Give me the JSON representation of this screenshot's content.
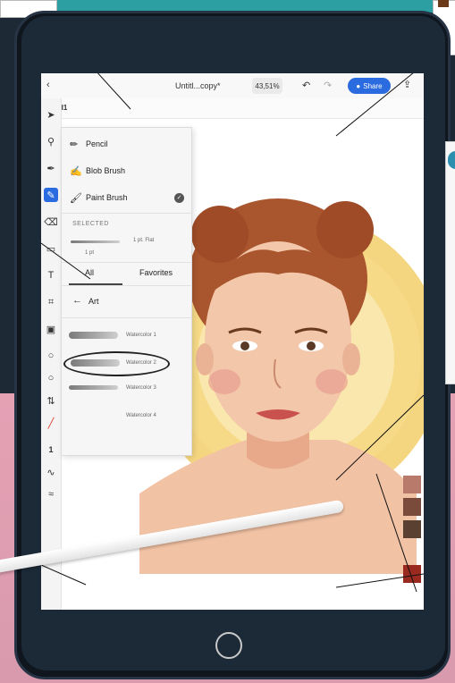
{
  "toolbar_top": {
    "back_icon": "chevron-left-icon",
    "doc_title": "Untitl...copy*",
    "zoom": "43,51%",
    "share_label": "Share",
    "layer_label": "d1"
  },
  "brush_panel": {
    "tools": [
      {
        "label": "Pencil",
        "icon": "pencil-icon"
      },
      {
        "label": "Blob Brush",
        "icon": "blob-brush-icon"
      },
      {
        "label": "Paint Brush",
        "icon": "paint-brush-icon",
        "selected": true
      }
    ],
    "selected_header": "SELECTED",
    "selected_stroke_label": "1 pt. Flat",
    "selected_size": "1 pt",
    "tabs": [
      "All",
      "Favorites"
    ],
    "category": "Art",
    "brushes": [
      "Watercolor 1",
      "Watercolor 2",
      "Watercolor 3",
      "Watercolor 4"
    ]
  },
  "left_tools": {
    "stroke_size": "1"
  },
  "colors": {
    "accent": "#2b6be0",
    "hair": "#a8542d",
    "skin": "#f2c4a6",
    "sun": "#f2c350",
    "swatches": [
      "#b87a6a",
      "#7a4a3a",
      "#5a4030",
      "#9a2a20"
    ]
  }
}
